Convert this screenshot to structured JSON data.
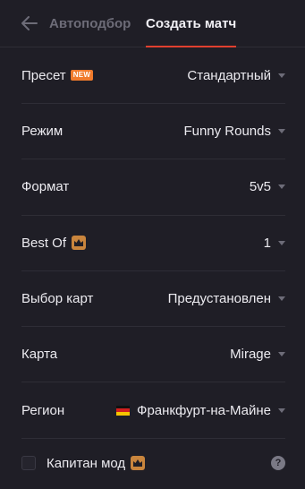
{
  "header": {
    "tab_autopick": "Автоподбор",
    "tab_create": "Создать матч"
  },
  "rows": [
    {
      "label": "Пресет",
      "badge": "NEW",
      "value": "Стандартный"
    },
    {
      "label": "Режим",
      "value": "Funny Rounds"
    },
    {
      "label": "Формат",
      "value": "5v5"
    },
    {
      "label": "Best Of",
      "value": "1"
    },
    {
      "label": "Выбор карт",
      "value": "Предустановлен"
    },
    {
      "label": "Карта",
      "value": "Mirage"
    },
    {
      "label": "Регион",
      "value": "Франкфурт-на-Майне"
    }
  ],
  "captain": {
    "label": "Капитан мод",
    "checked": false,
    "help": "?"
  },
  "colors": {
    "background": "#1f1e26",
    "accent": "#e0402f",
    "badge_new": "#f07b2c",
    "premium": "#c9853d"
  },
  "icons": {
    "back": "arrow-left-icon",
    "premium": "crown-icon",
    "region_flag": "germany-flag-icon",
    "dropdown": "caret-down-icon",
    "help": "question-mark-icon"
  }
}
